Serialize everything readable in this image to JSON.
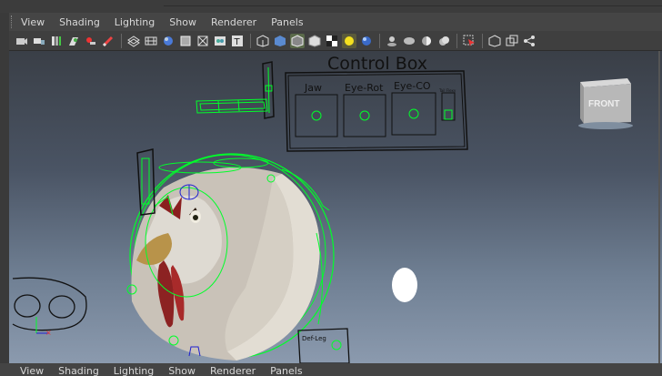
{
  "menu": [
    "View",
    "Shading",
    "Lighting",
    "Show",
    "Renderer",
    "Panels"
  ],
  "toolbar": {
    "icons": [
      "camera-select-icon",
      "camera-attributes-icon",
      "bookmark-icon",
      "image-plane-icon",
      "two-d-pan-icon",
      "grease-pencil-icon",
      "grid-icon",
      "film-gate-icon",
      "resolution-gate-icon",
      "gate-mask-icon",
      "field-chart-icon",
      "safe-title-icon",
      "wireframe-icon",
      "smooth-shade-icon",
      "wire-on-shaded-icon",
      "textured-icon",
      "use-all-lights-icon",
      "shadows-icon",
      "screen-space-ao-icon",
      "motion-blur-icon",
      "multisample-aa-icon",
      "depth-of-field-icon",
      "isolate-select-icon",
      "xray-icon",
      "xray-joints-icon",
      "xray-active-components-icon"
    ]
  },
  "viewport": {
    "control_box": {
      "title": "Control Box",
      "panels": [
        "Jaw",
        "Eye-Rot",
        "Eye-CO",
        "Tail Flexy"
      ]
    },
    "view_cube": {
      "label": "FRONT"
    },
    "deform_label": "Def-Leg"
  },
  "colors": {
    "control_curve": "#00ff2a",
    "viewport_top": "#3a3f47",
    "viewport_bottom": "#8b9aae",
    "menu_text": "#d8d8d8"
  }
}
